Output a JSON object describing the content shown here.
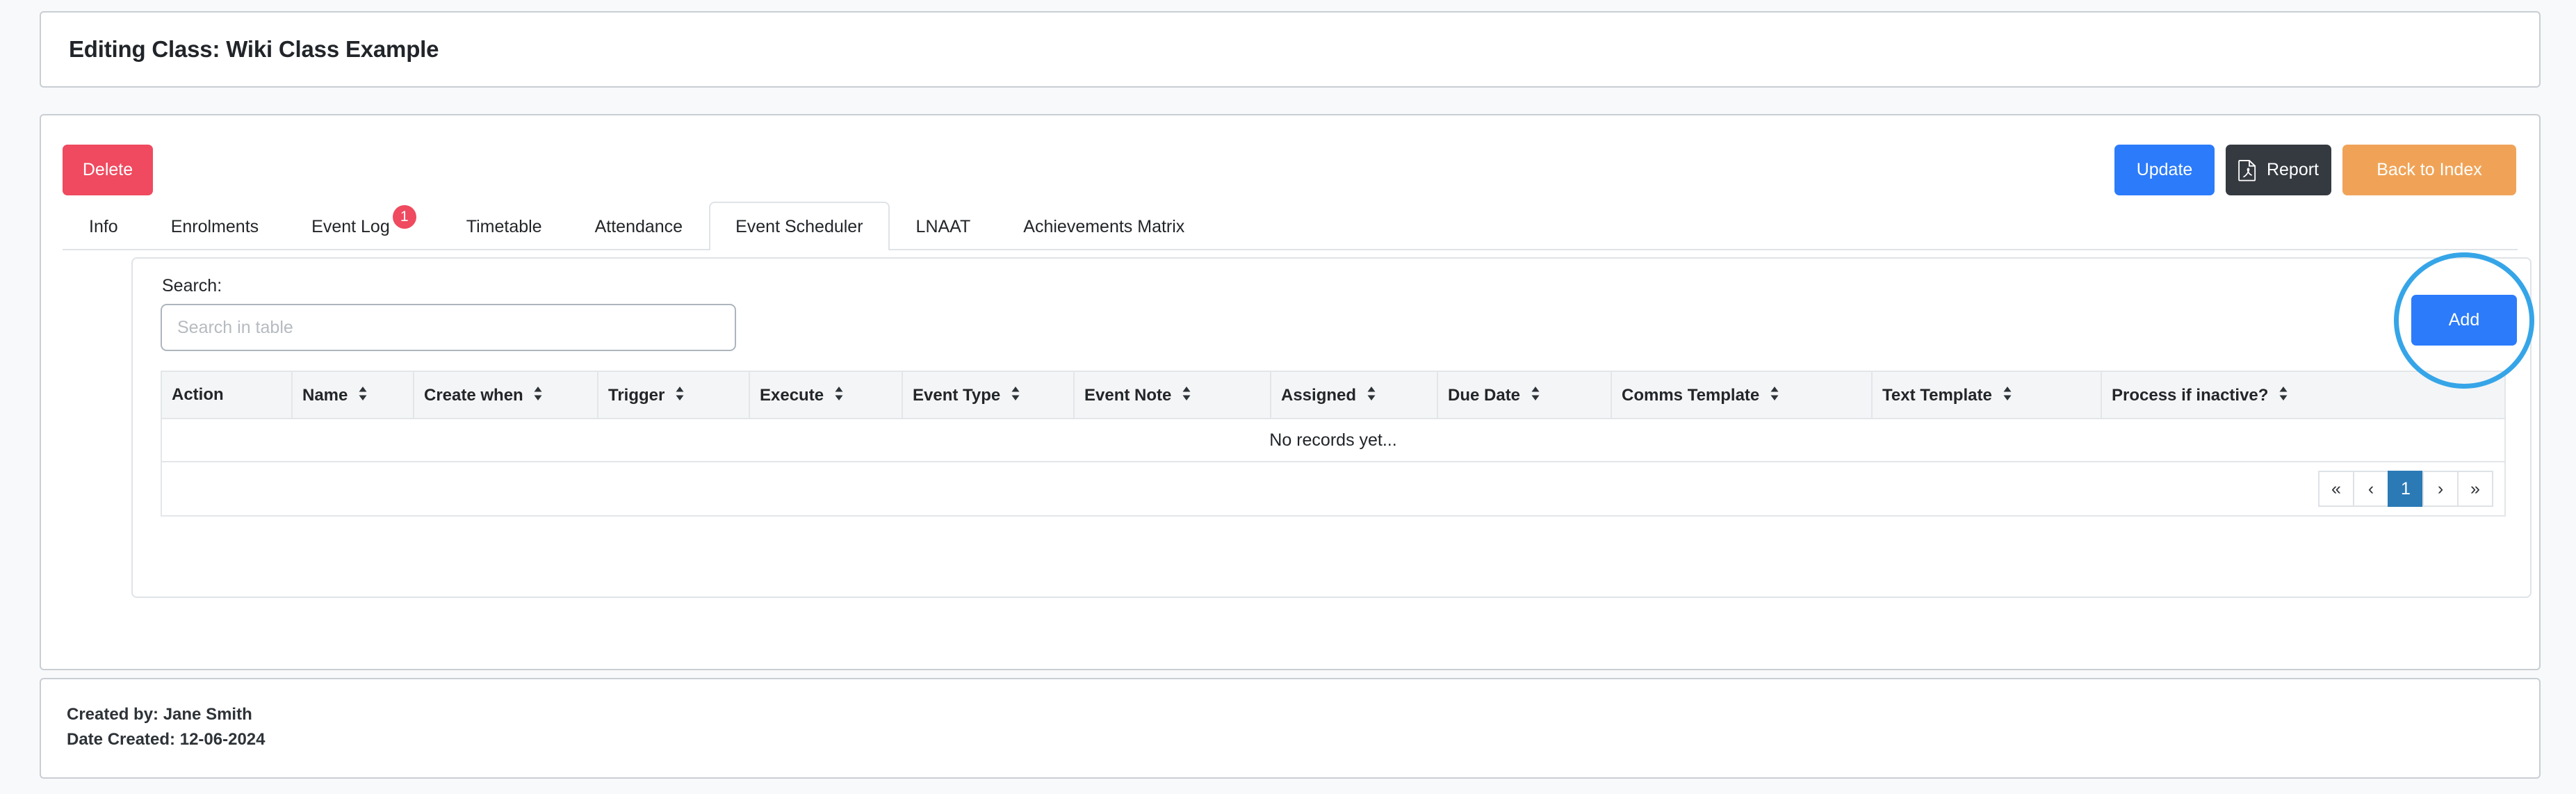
{
  "header": {
    "title": "Editing Class: Wiki Class Example"
  },
  "toolbar": {
    "delete_label": "Delete",
    "update_label": "Update",
    "report_label": "Report",
    "report_icon": "pdf-file-icon",
    "back_label": "Back to Index",
    "colors": {
      "delete": "#ef4a5f",
      "update": "#2b7bfb",
      "report": "#343a40",
      "back": "#f0a357"
    }
  },
  "tabs": [
    {
      "label": "Info",
      "active": false,
      "badge": null
    },
    {
      "label": "Enrolments",
      "active": false,
      "badge": null
    },
    {
      "label": "Event Log",
      "active": false,
      "badge": "1"
    },
    {
      "label": "Timetable",
      "active": false,
      "badge": null
    },
    {
      "label": "Attendance",
      "active": false,
      "badge": null
    },
    {
      "label": "Event Scheduler",
      "active": true,
      "badge": null
    },
    {
      "label": "LNAAT",
      "active": false,
      "badge": null
    },
    {
      "label": "Achievements Matrix",
      "active": false,
      "badge": null
    }
  ],
  "panel": {
    "search_label": "Search:",
    "search_value": "",
    "search_placeholder": "Search in table",
    "add_label": "Add",
    "annotation": {
      "type": "circle-highlight",
      "target": "add-button",
      "color": "#36a5e8"
    }
  },
  "table": {
    "columns": [
      {
        "label": "Action",
        "sortable": false
      },
      {
        "label": "Name",
        "sortable": true
      },
      {
        "label": "Create when",
        "sortable": true
      },
      {
        "label": "Trigger",
        "sortable": true
      },
      {
        "label": "Execute",
        "sortable": true
      },
      {
        "label": "Event Type",
        "sortable": true
      },
      {
        "label": "Event Note",
        "sortable": true
      },
      {
        "label": "Assigned",
        "sortable": true
      },
      {
        "label": "Due Date",
        "sortable": true
      },
      {
        "label": "Comms Template",
        "sortable": true
      },
      {
        "label": "Text Template",
        "sortable": true
      },
      {
        "label": "Process if inactive?",
        "sortable": true
      }
    ],
    "rows": [],
    "empty_message": "No records yet..."
  },
  "pagination": {
    "first_label": "«",
    "prev_label": "‹",
    "pages": [
      "1"
    ],
    "current_page": "1",
    "next_label": "›",
    "last_label": "»",
    "active_color": "#2b7ab5"
  },
  "footer": {
    "created_by": "Created by: Jane Smith",
    "date_created": "Date Created: 12-06-2024"
  }
}
